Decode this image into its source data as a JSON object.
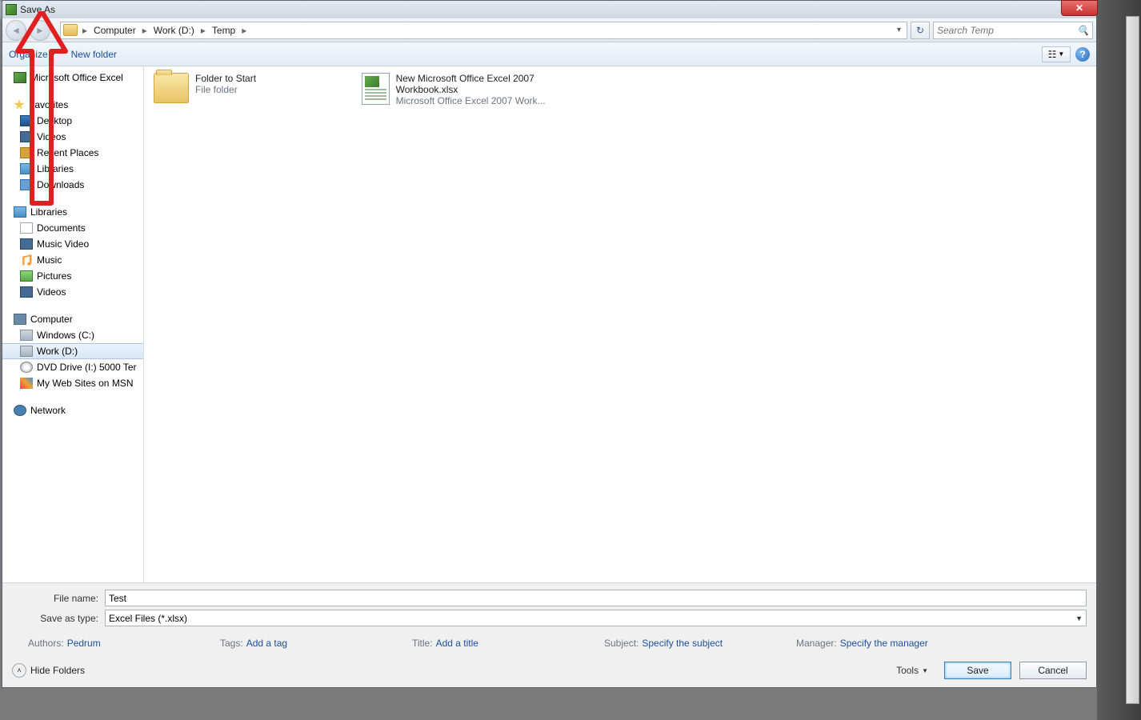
{
  "title": "Save As",
  "nav": {
    "breadcrumb": [
      "Computer",
      "Work (D:)",
      "Temp"
    ],
    "search_placeholder": "Search Temp"
  },
  "toolbar": {
    "organize": "Organize",
    "new_folder": "New folder"
  },
  "sidebar": {
    "top": "Microsoft Office Excel",
    "favorites": {
      "label": "Favorites",
      "items": [
        "Desktop",
        "Videos",
        "Recent Places",
        "Libraries",
        "Downloads"
      ]
    },
    "libraries": {
      "label": "Libraries",
      "items": [
        "Documents",
        "Music Video",
        "Music",
        "Pictures",
        "Videos"
      ]
    },
    "computer": {
      "label": "Computer",
      "items": [
        "Windows (C:)",
        "Work (D:)",
        "DVD Drive (I:) 5000 Ter",
        "My Web Sites on MSN"
      ]
    },
    "network": "Network"
  },
  "content": {
    "items": [
      {
        "name": "Folder to Start",
        "type": "File folder"
      },
      {
        "name": "New Microsoft Office Excel 2007 Workbook.xlsx",
        "type": "Microsoft Office Excel 2007 Work..."
      }
    ]
  },
  "bottom": {
    "filename_label": "File name:",
    "filename_value": "Test",
    "type_label": "Save as type:",
    "type_value": "Excel Files (*.xlsx)",
    "meta": {
      "authors_label": "Authors:",
      "authors_value": "Pedrum",
      "tags_label": "Tags:",
      "tags_value": "Add a tag",
      "title_label": "Title:",
      "title_value": "Add a title",
      "subject_label": "Subject:",
      "subject_value": "Specify the subject",
      "manager_label": "Manager:",
      "manager_value": "Specify the manager"
    },
    "hide_folders": "Hide Folders",
    "tools": "Tools",
    "save": "Save",
    "cancel": "Cancel"
  }
}
